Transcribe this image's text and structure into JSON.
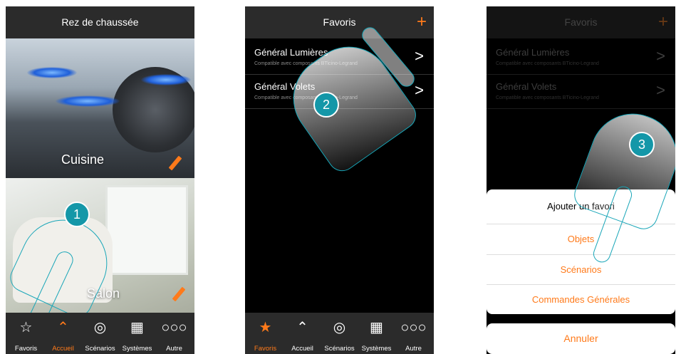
{
  "screen1": {
    "title": "Rez de chaussée",
    "rooms": [
      "Cuisine",
      "Salon"
    ],
    "step": "1"
  },
  "screen2": {
    "title": "Favoris",
    "plus": "+",
    "items": [
      {
        "title": "Général Lumières",
        "subtitle": "Compatible avec composants BTicino-Legrand"
      },
      {
        "title": "Général Volets",
        "subtitle": "Compatible avec composants BTicino-Legrand"
      }
    ],
    "step": "2"
  },
  "screen3": {
    "title": "Favoris",
    "plus": "+",
    "items": [
      {
        "title": "Général Lumières",
        "subtitle": "Compatible avec composants BTicino-Legrand"
      },
      {
        "title": "Général Volets",
        "subtitle": "Compatible avec composants BTicino-Legrand"
      }
    ],
    "sheet_title": "Ajouter un favori",
    "options": [
      "Objets",
      "Scénarios",
      "Commandes Générales"
    ],
    "cancel": "Annuler",
    "step": "3"
  },
  "tabs": [
    {
      "label": "Favoris",
      "icon": "star-icon"
    },
    {
      "label": "Accueil",
      "icon": "home-icon"
    },
    {
      "label": "Scénarios",
      "icon": "scenario-icon"
    },
    {
      "label": "Systèmes",
      "icon": "grid-icon"
    },
    {
      "label": "Autre",
      "icon": "more-icon"
    }
  ],
  "colors": {
    "accent": "#ff7a1a",
    "tabbar": "#2b2b2b",
    "hint": "#1497a8"
  }
}
